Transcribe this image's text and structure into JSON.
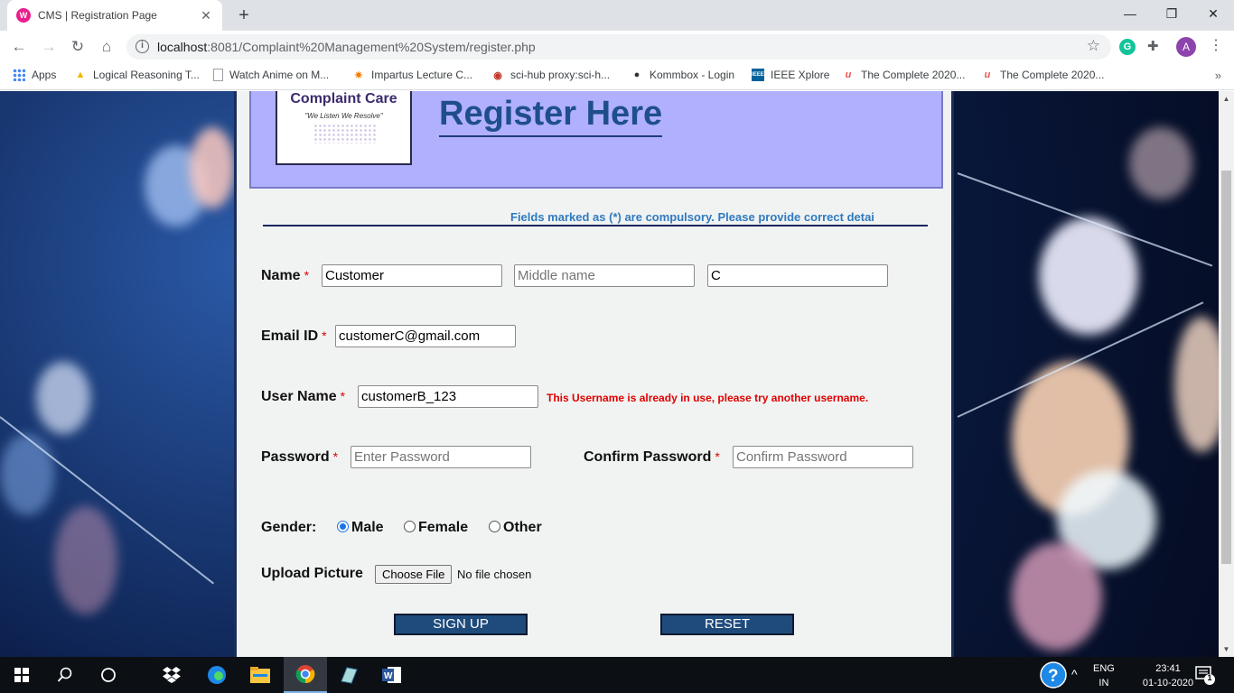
{
  "browser": {
    "tab_title": "CMS | Registration Page",
    "tab_favicon": "W",
    "url_host": "localhost",
    "url_rest": ":8081/Complaint%20Management%20System/register.php",
    "profile_initial": "A",
    "extension_initial": "G",
    "bookmarks": [
      {
        "label": "Apps",
        "icon": "apps-grid-icon"
      },
      {
        "label": "Logical Reasoning T...",
        "icon": "warning-triangle-icon"
      },
      {
        "label": "Watch Anime on M...",
        "icon": "page-icon"
      },
      {
        "label": "Impartus Lecture C...",
        "icon": "impartus-icon"
      },
      {
        "label": "sci-hub proxy:sci-h...",
        "icon": "eye-icon"
      },
      {
        "label": "Kommbox - Login",
        "icon": "globe-icon"
      },
      {
        "label": "IEEE Xplore",
        "icon": "ieee-icon"
      },
      {
        "label": "The Complete 2020...",
        "icon": "udemy-icon"
      },
      {
        "label": "The Complete 2020...",
        "icon": "udemy-icon"
      }
    ],
    "bookmarks_more": "»"
  },
  "header": {
    "logo_title": "Complaint Care",
    "logo_tagline": "\"We Listen We Resolve\"",
    "page_title": "Register Here"
  },
  "notice": "Fields marked as (*) are compulsory. Please provide correct detai",
  "form": {
    "required_mark": "*",
    "name": {
      "label": "Name",
      "first_value": "Customer",
      "middle_placeholder": "Middle name",
      "last_value": "C"
    },
    "email": {
      "label": "Email ID",
      "value": "customerC@gmail.com"
    },
    "username": {
      "label": "User Name",
      "value": "customerB_123",
      "error": "This Username is already in use, please try another username."
    },
    "password": {
      "label": "Password",
      "placeholder": "Enter Password"
    },
    "confirm_password": {
      "label": "Confirm Password",
      "placeholder": "Confirm Password"
    },
    "gender": {
      "label": "Gender:",
      "options": [
        "Male",
        "Female",
        "Other"
      ],
      "selected": "Male"
    },
    "upload": {
      "label": "Upload Picture",
      "button": "Choose File",
      "status": "No file chosen"
    },
    "signup_button": "SIGN UP",
    "reset_button": "RESET"
  },
  "taskbar": {
    "language": "ENG",
    "region": "IN",
    "time": "23:41",
    "date": "01-10-2020",
    "notification_count": "1"
  },
  "colors": {
    "header_bg": "#b0b0ff",
    "title_blue": "#1f4e8c",
    "notice_blue": "#2f7ac0",
    "error_red": "#e00000",
    "button_blue": "#1f4b7c"
  }
}
